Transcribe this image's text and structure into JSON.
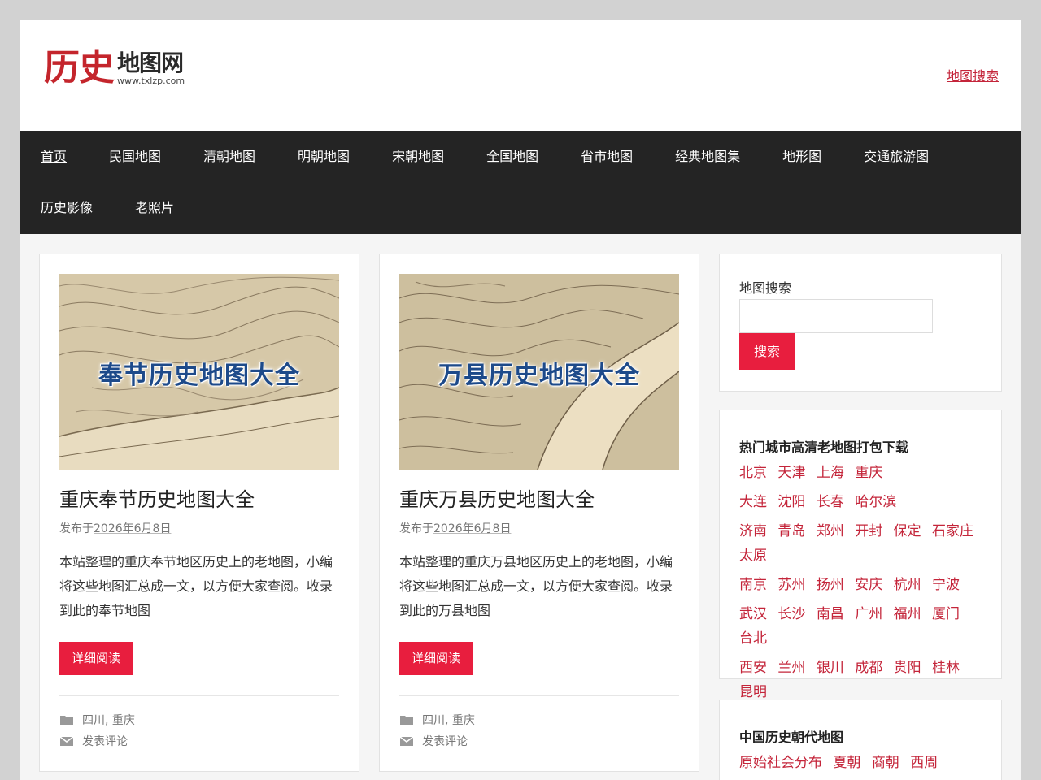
{
  "header": {
    "logo_big": "历史",
    "logo_small": "地图网",
    "logo_url": "www.txlzp.com",
    "search_link": "地图搜索"
  },
  "nav": {
    "items": [
      "首页",
      "民国地图",
      "清朝地图",
      "明朝地图",
      "宋朝地图",
      "全国地图",
      "省市地图",
      "经典地图集",
      "地形图",
      "交通旅游图",
      "历史影像",
      "老照片"
    ]
  },
  "posts": [
    {
      "thumb_text": "奉节历史地图大全",
      "title": "重庆奉节历史地图大全",
      "meta_prefix": "发布于",
      "date": "2026年6月8日",
      "excerpt": "本站整理的重庆奉节地区历史上的老地图，小编将这些地图汇总成一文，以方便大家查阅。收录到此的奉节地图",
      "read_more": "详细阅读",
      "categories": "四川, 重庆",
      "comment": "发表评论"
    },
    {
      "thumb_text": "万县历史地图大全",
      "title": "重庆万县历史地图大全",
      "meta_prefix": "发布于",
      "date": "2026年6月8日",
      "excerpt": "本站整理的重庆万县地区历史上的老地图，小编将这些地图汇总成一文，以方便大家查阅。收录到此的万县地图",
      "read_more": "详细阅读",
      "categories": "四川, 重庆",
      "comment": "发表评论"
    }
  ],
  "sidebar": {
    "search": {
      "label": "地图搜索",
      "value": "",
      "button": "搜索"
    },
    "hot_cities": {
      "title": "热门城市高清老地图打包下载",
      "rows": [
        [
          "北京",
          "天津",
          "上海",
          "重庆"
        ],
        [
          "大连",
          "沈阳",
          "长春",
          "哈尔滨"
        ],
        [
          "济南",
          "青岛",
          "郑州",
          "开封",
          "保定",
          "石家庄",
          "太原"
        ],
        [
          "南京",
          "苏州",
          "扬州",
          "安庆",
          "杭州",
          "宁波"
        ],
        [
          "武汉",
          "长沙",
          "南昌",
          "广州",
          "福州",
          "厦门",
          "台北"
        ],
        [
          "西安",
          "兰州",
          "银川",
          "成都",
          "贵阳",
          "桂林",
          "昆明"
        ]
      ]
    },
    "dynasty": {
      "title": "中国历史朝代地图",
      "rows": [
        [
          "原始社会分布",
          "夏朝",
          "商朝",
          "西周"
        ]
      ]
    }
  },
  "colors": {
    "accent": "#e81e3e",
    "link": "#c4253a",
    "nav_bg": "#242424",
    "logo_red": "#c4252c"
  }
}
